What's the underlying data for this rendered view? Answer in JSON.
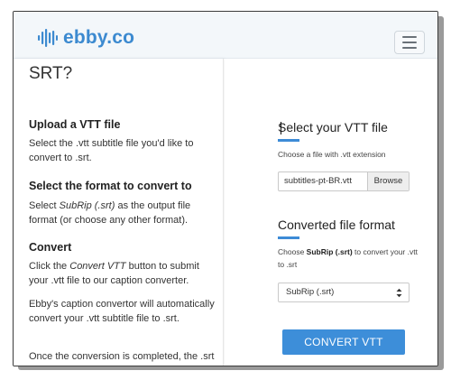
{
  "header": {
    "logo_text": "ebby.co",
    "logo_icon": "sound-wave-icon",
    "menu_icon": "hamburger-menu-icon"
  },
  "left": {
    "heading": "SRT?",
    "steps": [
      {
        "title": "Upload a VTT file",
        "text": "Select the .vtt subtitle file you'd like to convert to .srt."
      },
      {
        "title": "Select the format to convert to",
        "text_before": "Select ",
        "text_em": "SubRip (.srt)",
        "text_after": " as the output file format (or choose any other format)."
      },
      {
        "title": "Convert",
        "text_before": "Click the ",
        "text_em": "Convert VTT",
        "text_after": " button to submit your .vtt file to our caption converter."
      }
    ],
    "para_auto": "Ebby's caption convertor will automatically convert your .vtt subtitle file to .srt.",
    "para_once": "Once the conversion is completed, the .srt"
  },
  "right": {
    "select_title": "Select your VTT file",
    "select_sub": "Choose a file with .vtt extension",
    "file_name": "subtitles-pt-BR.vtt",
    "browse_label": "Browse",
    "format_title": "Converted file format",
    "format_sub_before": "Choose ",
    "format_sub_bold": "SubRip (.srt)",
    "format_sub_after": " to convert your .vtt to .srt",
    "format_value": "SubRip (.srt)",
    "convert_label": "CONVERT VTT"
  },
  "colors": {
    "accent": "#3d8ed9",
    "logo": "#3c8ad0",
    "header_bg": "#f3f7fa"
  }
}
